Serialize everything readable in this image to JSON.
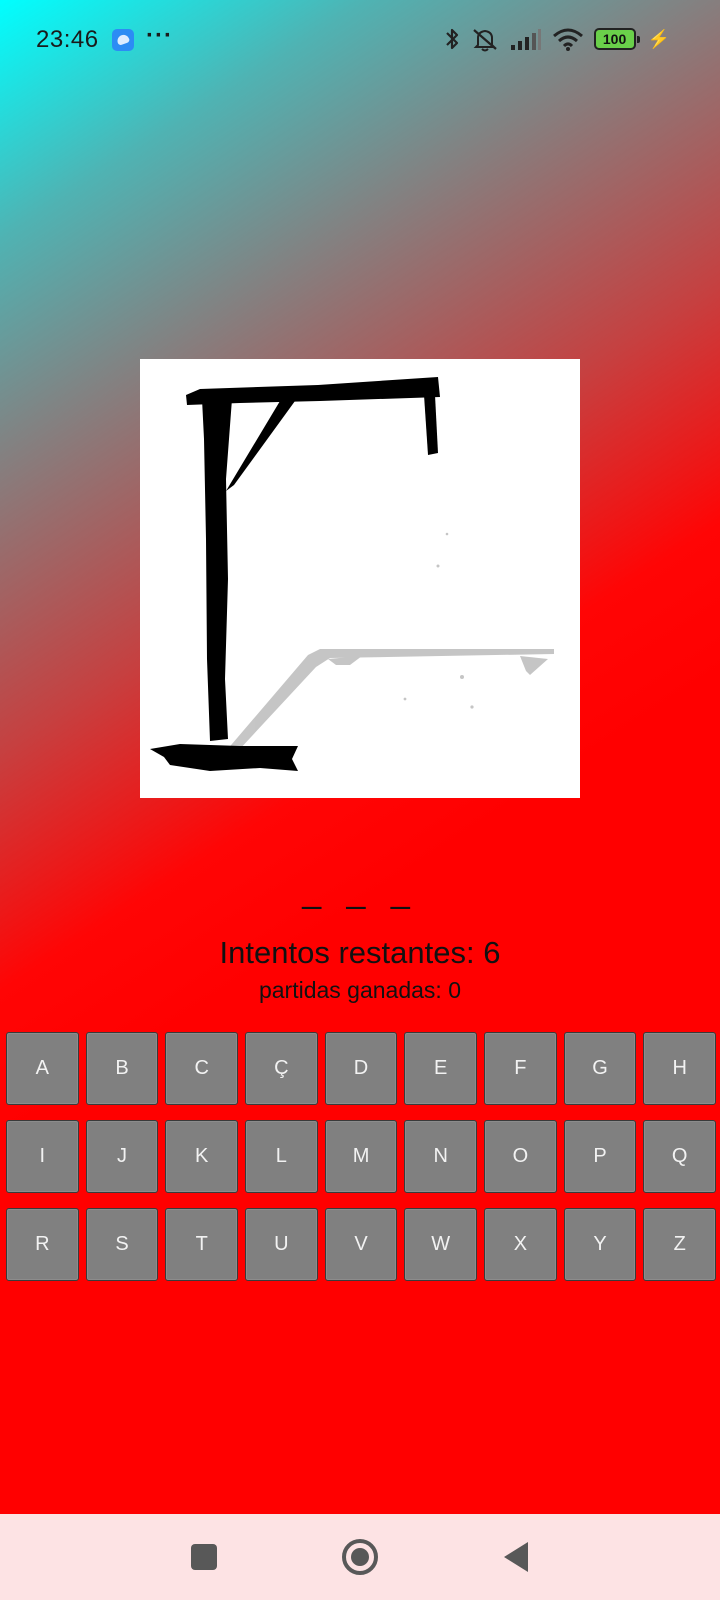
{
  "status_bar": {
    "time": "23:46",
    "more_indicator": "···",
    "battery_level": "100",
    "icons": [
      "app-notification-icon",
      "bluetooth-icon",
      "mute-icon",
      "cell-signal-icon",
      "wifi-icon",
      "battery-icon",
      "charging-icon"
    ]
  },
  "game": {
    "hangman_stage": 0,
    "word_mask": "_ _ _",
    "attempts_text": "Intentos restantes: 6",
    "wins_text": "partidas ganadas: 0"
  },
  "keyboard": {
    "rows": [
      [
        "A",
        "B",
        "C",
        "Ç",
        "D",
        "E",
        "F",
        "G",
        "H"
      ],
      [
        "I",
        "J",
        "K",
        "L",
        "M",
        "N",
        "O",
        "P",
        "Q"
      ],
      [
        "R",
        "S",
        "T",
        "U",
        "V",
        "W",
        "X",
        "Y",
        "Z"
      ]
    ],
    "key_color": "#808080"
  },
  "nav_bar": {
    "buttons": [
      "recents-icon",
      "home-icon",
      "back-icon"
    ]
  },
  "colors": {
    "gradient_start": "#00ffff",
    "gradient_end": "#ff0000",
    "nav_background": "#fde3e4"
  }
}
